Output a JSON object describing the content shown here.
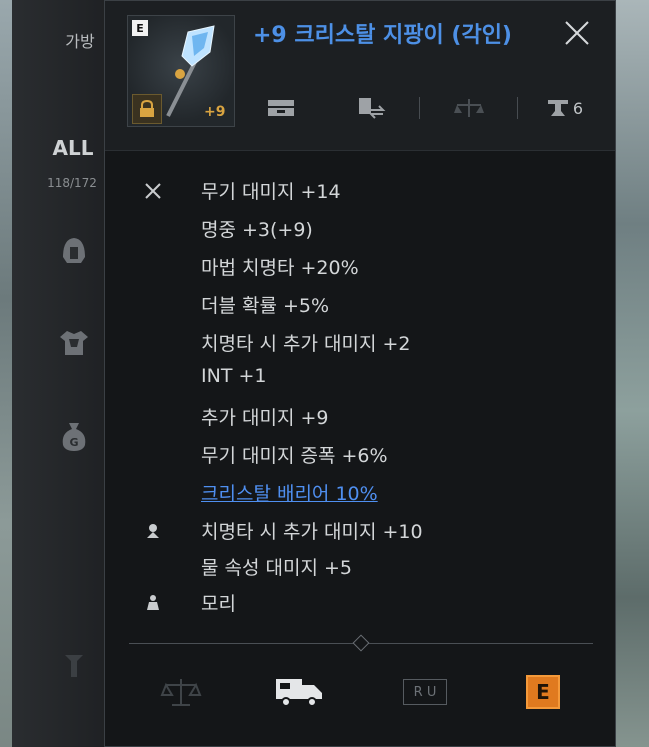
{
  "sidebar": {
    "tab_label": "가방",
    "filter_label": "ALL",
    "count_label": "118/172",
    "icons": [
      "helmet-icon",
      "armor-icon",
      "money-bag-icon",
      "tool-icon"
    ]
  },
  "item": {
    "grade_badge": "E",
    "name": "+9 크리스탈 지팡이 (각인)",
    "enhance_level": "+9",
    "header_icons": {
      "storage": "storage-icon",
      "trade": "trade-icon",
      "balance": "balance-icon",
      "upgrade_count": "6"
    }
  },
  "stats": [
    {
      "icon": "sword-icon",
      "text": "무기 대미지 +14",
      "type": "normal"
    },
    {
      "icon": "",
      "text": "명중 +3(+9)",
      "type": "normal"
    },
    {
      "icon": "",
      "text": "마법 치명타 +20%",
      "type": "normal"
    },
    {
      "icon": "",
      "text": "더블 확률 +5%",
      "type": "normal"
    },
    {
      "icon": "",
      "text": "치명타 시 추가 대미지 +2",
      "type": "normal"
    },
    {
      "icon": "",
      "text": "INT +1",
      "type": "normal"
    },
    {
      "icon": "",
      "text": "추가 대미지 +9",
      "type": "normal"
    },
    {
      "icon": "",
      "text": "무기 대미지 증폭 +6%",
      "type": "normal"
    },
    {
      "icon": "",
      "text": "크리스탈 배리어 10%",
      "type": "set"
    },
    {
      "icon": "engrave-icon",
      "text": "치명타 시 추가 대미지 +10",
      "type": "normal"
    },
    {
      "icon": "",
      "text": "물 속성 대미지 +5",
      "type": "normal"
    },
    {
      "icon": "weight-icon",
      "text": "모리",
      "type": "normal"
    }
  ],
  "footer": {
    "ru_label": "R U",
    "equip_label": "E",
    "buttons": [
      "scale-icon",
      "delivery-truck-icon",
      "ru-box",
      "equip-button"
    ]
  },
  "colors": {
    "item_name": "#4d90e6",
    "set_effect": "#4f8ff0",
    "enhance": "#d9a441",
    "equip_button": "#e07a1f"
  }
}
